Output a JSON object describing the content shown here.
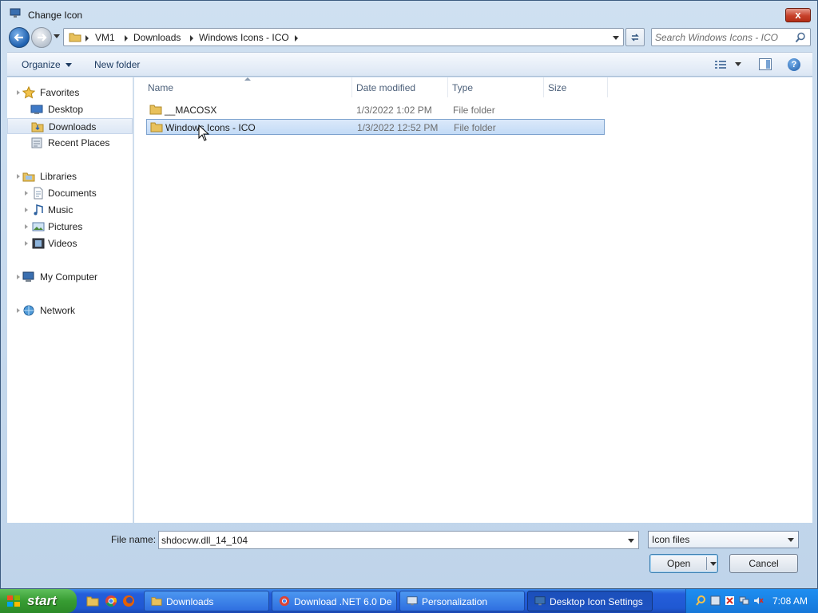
{
  "window": {
    "title": "Change Icon",
    "close_label": "x"
  },
  "address": {
    "crumbs": [
      "VM1",
      "Downloads",
      "Windows Icons - ICO"
    ],
    "search_placeholder": "Search Windows Icons - ICO"
  },
  "toolbar": {
    "organize_label": "Organize",
    "new_folder_label": "New folder",
    "help_label": "?"
  },
  "nav": {
    "favorites": "Favorites",
    "desktop": "Desktop",
    "downloads": "Downloads",
    "recent_places": "Recent Places",
    "libraries": "Libraries",
    "documents": "Documents",
    "music": "Music",
    "pictures": "Pictures",
    "videos": "Videos",
    "my_computer": "My Computer",
    "network": "Network"
  },
  "columns": {
    "name": "Name",
    "date_modified": "Date modified",
    "type": "Type",
    "size": "Size"
  },
  "files": [
    {
      "name": "__MACOSX",
      "date": "1/3/2022 1:02 PM",
      "type": "File folder"
    },
    {
      "name": "Windows Icons - ICO",
      "date": "1/3/2022 12:52 PM",
      "type": "File folder"
    }
  ],
  "footer": {
    "filename_label": "File name:",
    "filename_value": "shdocvw.dll_14_104",
    "filter_value": "Icon files",
    "open_label": "Open",
    "cancel_label": "Cancel"
  },
  "taskbar": {
    "start_label": "start",
    "buttons": [
      "Downloads",
      "Download .NET 6.0 De...",
      "Personalization",
      "Desktop Icon Settings"
    ],
    "clock": "7:08 AM"
  },
  "colors": {
    "selection": "#c3dbf6",
    "taskbar": "#245edb",
    "start": "#379c32"
  }
}
